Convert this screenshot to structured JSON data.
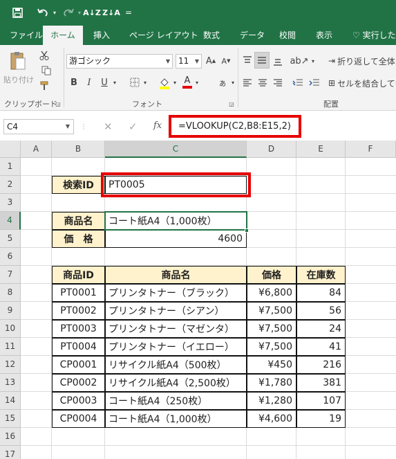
{
  "qat": {
    "save_icon": "save-icon",
    "undo_icon": "undo-icon",
    "redo_icon": "redo-icon",
    "sort_asc": "A↓Z",
    "sort_desc": "Z↓A",
    "more": "="
  },
  "tabs": [
    "ファイル",
    "ホーム",
    "挿入",
    "ページ レイアウト",
    "数式",
    "データ",
    "校閲",
    "表示",
    "実行したい"
  ],
  "ribbon": {
    "paste_label": "貼り付け",
    "clipboard_label": "クリップボード",
    "font_name": "游ゴシック",
    "font_size": "11",
    "bold": "B",
    "italic": "I",
    "underline": "U",
    "font_group_label": "フォント",
    "wrap_text": "折り返して全体を",
    "merge_center": "セルを結合して中",
    "align_group_label": "配置",
    "accent_color": "#217346"
  },
  "formula_bar": {
    "name_box": "C4",
    "cancel": "✕",
    "enter": "✓",
    "fx": "fx",
    "formula": "=VLOOKUP(C2,B8:E15,2)"
  },
  "columns": [
    "A",
    "B",
    "C",
    "D",
    "E",
    "F"
  ],
  "rows": [
    "1",
    "2",
    "3",
    "4",
    "5",
    "6",
    "7",
    "8",
    "9",
    "10",
    "11",
    "12",
    "13",
    "14",
    "15",
    "16",
    "17"
  ],
  "lookup": {
    "search_label": "検索ID",
    "search_value": "PT0005",
    "name_label": "商品名",
    "name_value": "コート紙A4（1,000枚）",
    "price_label": "価　格",
    "price_value": "4600"
  },
  "table": {
    "headers": [
      "商品ID",
      "商品名",
      "価格",
      "在庫数"
    ],
    "rows": [
      [
        "PT0001",
        "プリンタトナー（ブラック）",
        "¥6,800",
        "84"
      ],
      [
        "PT0002",
        "プリンタトナー（シアン）",
        "¥7,500",
        "56"
      ],
      [
        "PT0003",
        "プリンタトナー（マゼンタ）",
        "¥7,500",
        "24"
      ],
      [
        "PT0004",
        "プリンタトナー（イエロー）",
        "¥7,500",
        "41"
      ],
      [
        "CP0001",
        "リサイクル紙A4（500枚）",
        "¥450",
        "216"
      ],
      [
        "CP0002",
        "リサイクル紙A4（2,500枚）",
        "¥1,780",
        "381"
      ],
      [
        "CP0003",
        "コート紙A4（250枚）",
        "¥1,280",
        "107"
      ],
      [
        "CP0004",
        "コート紙A4（1,000枚）",
        "¥4,600",
        "19"
      ]
    ]
  },
  "highlight_color": "#e60000",
  "header_fill": "#fff2cc"
}
